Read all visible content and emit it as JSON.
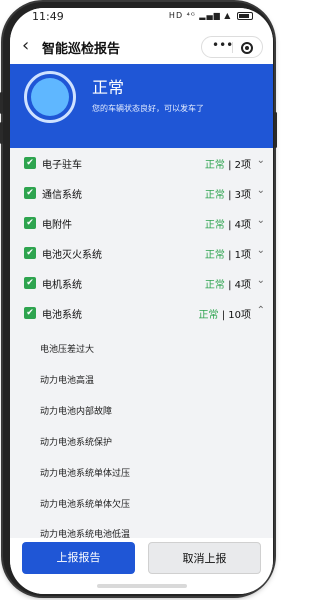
{
  "status_bar": {
    "time": "11:49",
    "icons": "HD ⁴ᴳ ▂▄▆ ▲"
  },
  "nav": {
    "back_icon": "‹",
    "title": "智能巡检报告",
    "more_icon": "•••"
  },
  "banner": {
    "status": "正常",
    "message": "您的车辆状态良好，可以发车了"
  },
  "items": [
    {
      "name": "电子驻车",
      "status": "正常",
      "count": " | 2项",
      "chevron": "⌄"
    },
    {
      "name": "通信系统",
      "status": "正常",
      "count": " | 3项",
      "chevron": "⌄"
    },
    {
      "name": "电附件",
      "status": "正常",
      "count": " | 4项",
      "chevron": "⌄"
    },
    {
      "name": "电池灭火系统",
      "status": "正常",
      "count": " | 1项",
      "chevron": "⌄"
    },
    {
      "name": "电机系统",
      "status": "正常",
      "count": " | 4项",
      "chevron": "⌄"
    },
    {
      "name": "电池系统",
      "status": "正常",
      "count": " | 10项",
      "chevron": "⌃"
    }
  ],
  "sub_items": [
    "电池压差过大",
    "动力电池高温",
    "动力电池内部故障",
    "动力电池系统保护",
    "动力电池系统单体过压",
    "动力电池系统单体欠压",
    "动力电池系统电池低温"
  ],
  "buttons": {
    "report": "上报报告",
    "cancel": "取消上报"
  },
  "colors": {
    "primary": "#1f56d6",
    "ok": "#2ea44f"
  }
}
